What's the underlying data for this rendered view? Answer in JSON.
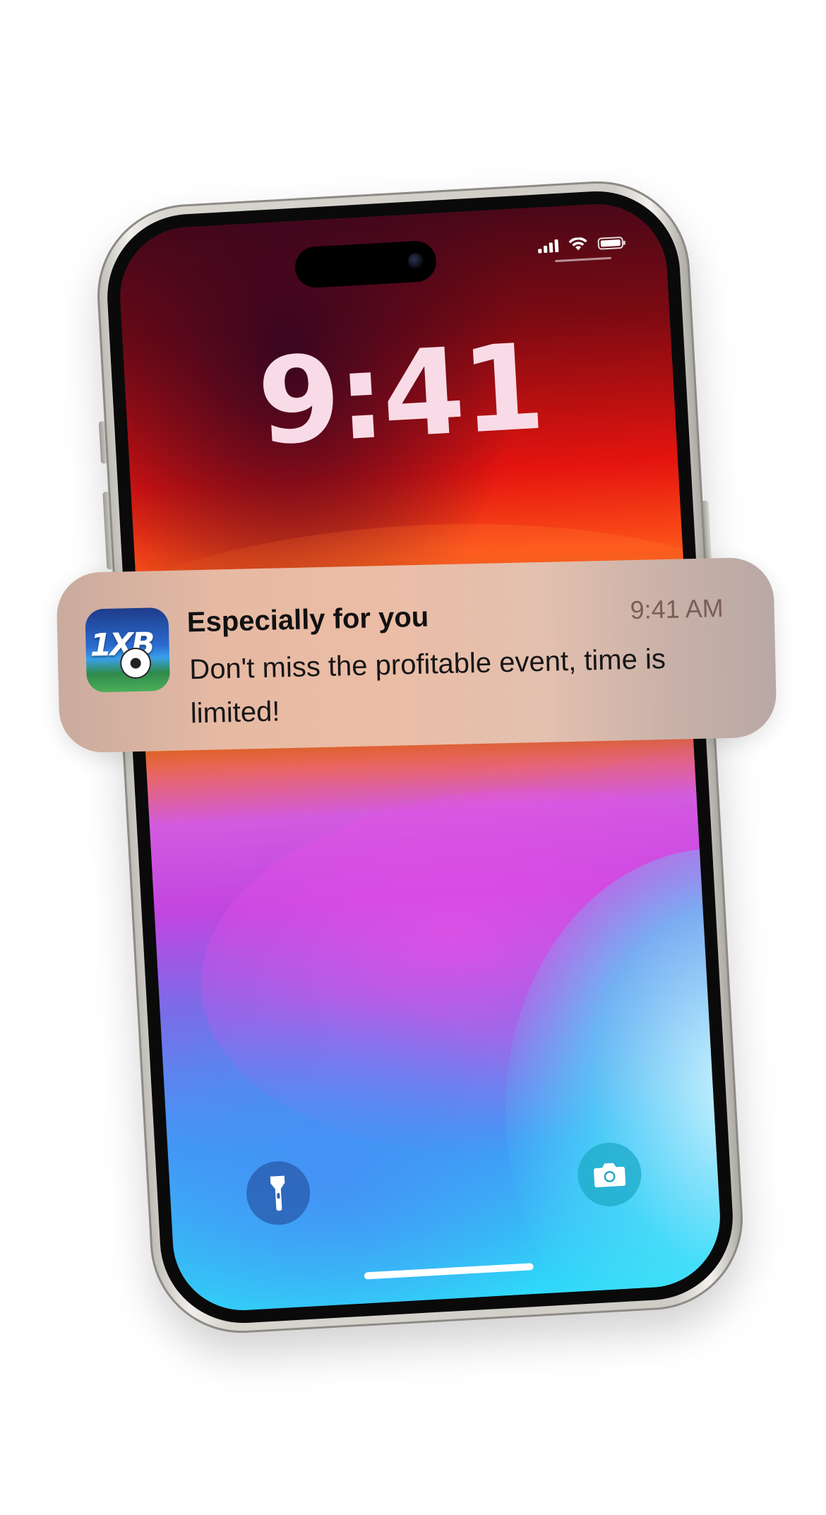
{
  "lock_screen": {
    "time": "9:41"
  },
  "status_bar": {
    "icons": [
      "cellular-signal-icon",
      "wifi-icon",
      "battery-icon"
    ]
  },
  "notification": {
    "app_icon": "1xbet-app-icon",
    "app_icon_text": "1XB",
    "title": "Especially for you",
    "time": "9:41 AM",
    "body": "Don't miss the profitable event, time is limited!"
  },
  "quick_actions": {
    "left": "flashlight-icon",
    "right": "camera-icon"
  },
  "colors": {
    "clock": "#f8dbe6",
    "notification_bg": "#e6b9a3",
    "notification_time": "#7a5e56",
    "title": "#111111"
  }
}
